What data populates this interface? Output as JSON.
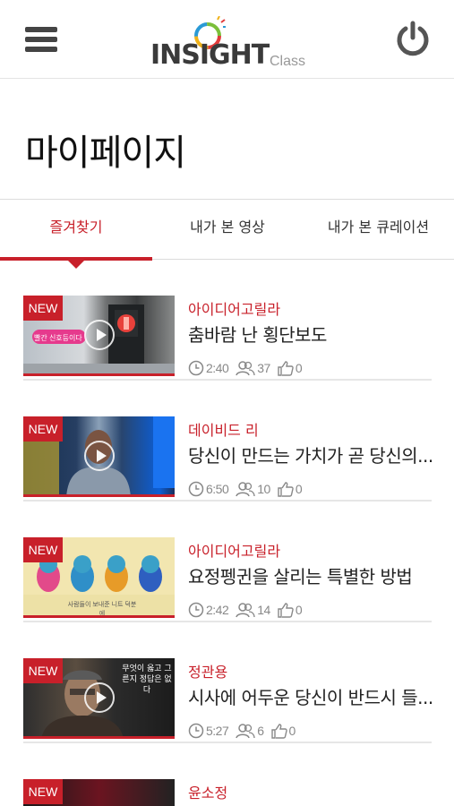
{
  "header": {
    "logo_text": "INSIGHT",
    "logo_sub": "Class",
    "menu_icon": "hamburger-menu-icon",
    "power_icon": "power-icon"
  },
  "page": {
    "title": "마이페이지"
  },
  "tabs": [
    {
      "label": "즐겨찾기",
      "active": true
    },
    {
      "label": "내가 본 영상",
      "active": false
    },
    {
      "label": "내가 본 큐레이션",
      "active": false
    }
  ],
  "colors": {
    "accent": "#c8202a",
    "text": "#222222",
    "meta": "#888888"
  },
  "items": [
    {
      "badge": "NEW",
      "author": "아이디어고릴라",
      "title": "춤바람 난 횡단보도",
      "duration": "2:40",
      "views": "37",
      "likes": "0",
      "thumb_caption": "빨간 신호등이다"
    },
    {
      "badge": "NEW",
      "author": "데이비드 리",
      "title": "당신이 만드는 가치가 곧 당신의...",
      "duration": "6:50",
      "views": "10",
      "likes": "0",
      "thumb_caption": ""
    },
    {
      "badge": "NEW",
      "author": "아이디어고릴라",
      "title": "요정펭귄을 살리는 특별한 방법",
      "duration": "2:42",
      "views": "14",
      "likes": "0",
      "thumb_caption": "사람들이 보내준 니트 덕분에"
    },
    {
      "badge": "NEW",
      "author": "정관용",
      "title": "시사에 어두운 당신이 반드시 들...",
      "duration": "5:27",
      "views": "6",
      "likes": "0",
      "thumb_caption": "무엇이 옳고 그른지 정답은 없다"
    },
    {
      "badge": "NEW",
      "author": "윤소정",
      "title": "",
      "duration": "",
      "views": "",
      "likes": "",
      "thumb_caption": ""
    }
  ]
}
